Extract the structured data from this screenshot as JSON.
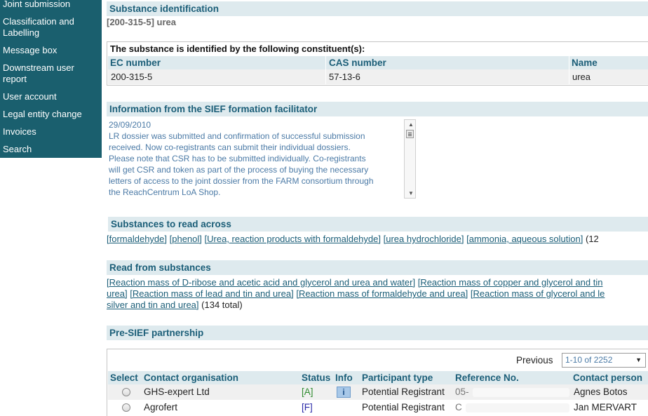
{
  "sidebar": {
    "items": [
      {
        "label": "Joint submission"
      },
      {
        "label": "Classification and Labelling"
      },
      {
        "label": "Message box"
      },
      {
        "label": "Downstream user report"
      },
      {
        "label": "User account"
      },
      {
        "label": "Legal entity change"
      },
      {
        "label": "Invoices"
      },
      {
        "label": "Search"
      }
    ]
  },
  "substance": {
    "header": "Substance identification",
    "id_text": "[200-315-5] urea"
  },
  "constituents": {
    "title": "The substance is identified by the following constituent(s):",
    "columns": [
      "EC number",
      "CAS number",
      "Name"
    ],
    "rows": [
      [
        "200-315-5",
        "57-13-6",
        "urea"
      ]
    ]
  },
  "sief_info": {
    "header": "Information from the SIEF formation facilitator",
    "date": "29/09/2010",
    "lines": [
      "LR dossier was submitted and confirmation of successful submission",
      "received. Now co-registrants can submit their individual dossiers.",
      "Please note that CSR has to be submitted individually. Co-registrants",
      "will get CSR and token as part of the process of buying the necessary",
      "letters of access to the joint dossier from the FARM consortium through",
      "the ReachCentrum LoA Shop."
    ]
  },
  "read_across": {
    "header": "Substances to read across",
    "links": [
      "[formaldehyde]",
      "[phenol]",
      "[Urea, reaction products with formaldehyde]",
      "[urea hydrochloride]",
      "[ammonia, aqueous solution]"
    ],
    "suffix": "(12"
  },
  "read_from": {
    "header": "Read from substances",
    "line1": [
      "[Reaction mass of D-ribose and acetic acid and glycerol and urea and water]",
      "[Reaction mass of copper and glycerol and tin"
    ],
    "line2": [
      "urea]",
      "[Reaction mass of lead and tin and urea]",
      "[Reaction mass of formaldehyde and urea]",
      "[Reaction mass of glycerol and le"
    ],
    "line3": [
      "silver and tin and urea]"
    ],
    "total": "(134 total)"
  },
  "presief": {
    "header": "Pre-SIEF partnership",
    "previous_label": "Previous",
    "page_select": "1-10 of 2252",
    "columns": [
      "Select",
      "Contact organisation",
      "Status",
      "Info",
      "Participant type",
      "Reference No.",
      "Contact person"
    ],
    "rows": [
      {
        "org": "GHS-expert Ltd",
        "status": "[A]",
        "status_color": "#2e8b2e",
        "info": "i",
        "type": "Potential Registrant",
        "ref": "05-",
        "person": "Agnes Botos"
      },
      {
        "org": "Agrofert",
        "status": "[F]",
        "status_color": "#2a2aa8",
        "info": "",
        "type": "Potential Registrant",
        "ref": "C",
        "person": "Jan MERVART"
      }
    ]
  }
}
